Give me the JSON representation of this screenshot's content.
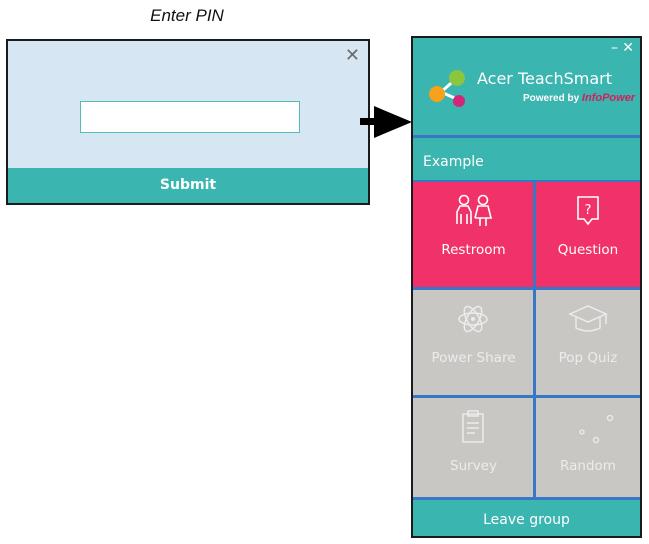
{
  "caption": "Enter PIN",
  "pin_dialog": {
    "close_icon": "close-icon",
    "close_glyph": "✕",
    "input_value": "",
    "input_placeholder": "",
    "submit_label": "Submit"
  },
  "panel": {
    "app_title": "Acer TeachSmart",
    "powered_by": "Powered by",
    "powered_brand": "InfoPower",
    "minimize_glyph": "–",
    "close_glyph": "✕",
    "group_name": "Example",
    "tiles": [
      {
        "label": "Restroom",
        "icon": "restroom-icon",
        "state": "active"
      },
      {
        "label": "Question",
        "icon": "question-icon",
        "state": "active"
      },
      {
        "label": "Power Share",
        "icon": "atom-icon",
        "state": "disabled"
      },
      {
        "label": "Pop Quiz",
        "icon": "graduation-cap-icon",
        "state": "disabled"
      },
      {
        "label": "Survey",
        "icon": "clipboard-icon",
        "state": "disabled"
      },
      {
        "label": "Random",
        "icon": "dots-icon",
        "state": "disabled"
      }
    ],
    "leave_label": "Leave group"
  },
  "colors": {
    "teal": "#3ab5b0",
    "pink": "#f03268",
    "gray": "#c8c7c3",
    "divider_blue": "#3876c6",
    "dialog_bg": "#d6e6f2"
  }
}
